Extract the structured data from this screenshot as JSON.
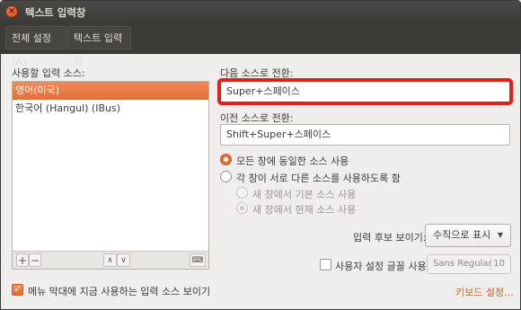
{
  "window": {
    "title": "텍스트 입력창"
  },
  "tabs": [
    {
      "label": "전체 설정(A)"
    },
    {
      "label": "텍스트 입력창"
    }
  ],
  "left": {
    "sources_label": "사용할 입력 소스:",
    "sources": [
      {
        "label": "영어(미국)",
        "selected": true
      },
      {
        "label": "한국어 (Hangul) (IBus)",
        "selected": false
      }
    ],
    "toolbar": {
      "add": "+",
      "remove": "−",
      "up": "∧",
      "down": "∨",
      "keyboard": "⌨"
    },
    "show_menu_checkbox": {
      "label": "메뉴 막대에 지금 사용하는 입력 소스 보이기",
      "checked": true
    }
  },
  "right": {
    "next_label": "다음 소스로 전환:",
    "next_value": "Super+스페이스",
    "prev_label": "이전 소스로 전환:",
    "prev_value": "Shift+Super+스페이스",
    "radios": [
      {
        "label": "모든 창에 동일한 소스 사용",
        "checked": true,
        "disabled": false
      },
      {
        "label": "각 창이 서로 다른 소스를 사용하도록 함",
        "checked": false,
        "disabled": false
      },
      {
        "label": "새 창에서 기본 소스 사용",
        "checked": false,
        "disabled": true
      },
      {
        "label": "새 창에서 현재 소스 사용",
        "checked": true,
        "disabled": true
      }
    ],
    "candidate_label": "입력 후보 보이기:",
    "candidate_value": "수직으로 표시",
    "custom_font_label": "사용자 설정 글꼴 사용:",
    "custom_font_checked": false,
    "font_name": "Sans Regular",
    "font_size": "10",
    "keyboard_settings_link": "키보드 설정..."
  },
  "colors": {
    "accent": "#e36f38",
    "highlight_box": "#e0201a",
    "titlebar": "#3c3b37"
  }
}
